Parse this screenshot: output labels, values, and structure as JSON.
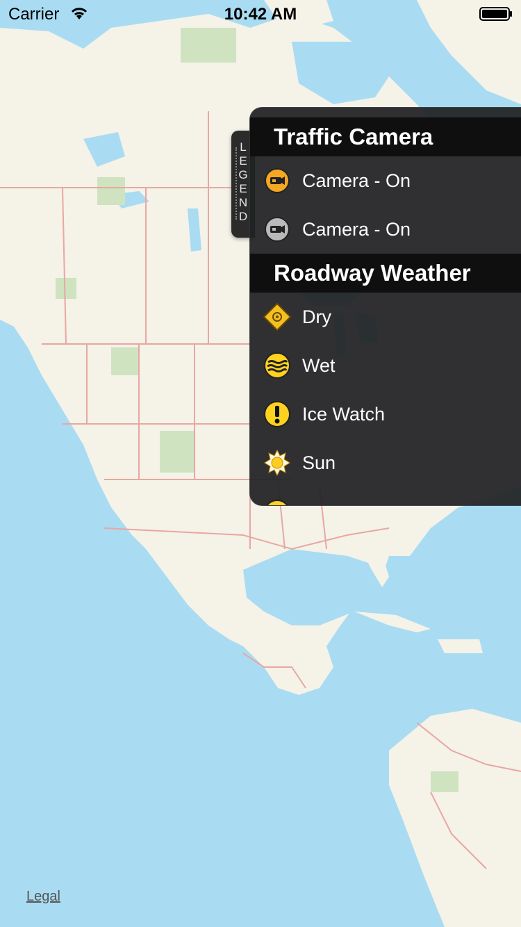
{
  "status_bar": {
    "carrier": "Carrier",
    "time": "10:42 AM",
    "wifi_icon": "wifi-icon",
    "battery_icon": "battery-icon"
  },
  "legend_tab": {
    "letters": [
      "L",
      "E",
      "G",
      "E",
      "N",
      "D"
    ]
  },
  "legend": {
    "sections": [
      {
        "title": "Traffic Camera",
        "items": [
          {
            "label": "Camera - On",
            "icon": "camera-orange-icon",
            "color": "#f5a623"
          },
          {
            "label": "Camera - On",
            "icon": "camera-gray-icon",
            "color": "#b9b9b9"
          }
        ]
      },
      {
        "title": "Roadway Weather",
        "items": [
          {
            "label": "Dry",
            "icon": "dry-diamond-icon",
            "color": "#f4c021"
          },
          {
            "label": "Wet",
            "icon": "wet-icon",
            "color": "#ffd21f"
          },
          {
            "label": "Ice Watch",
            "icon": "ice-watch-icon",
            "color": "#ffd21f"
          },
          {
            "label": "Sun",
            "icon": "sun-icon",
            "color": "#ffcc22"
          }
        ]
      }
    ]
  },
  "map": {
    "legal": "Legal",
    "water_color": "#a9dcf2",
    "land_color": "#f5f2e8",
    "border_color": "#e8a7a2",
    "park_color": "#cfe3c0"
  }
}
